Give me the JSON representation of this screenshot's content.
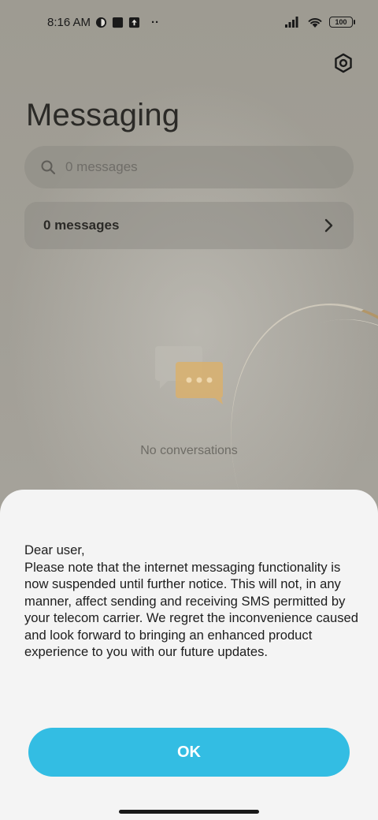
{
  "status_bar": {
    "time": "8:16 AM",
    "battery": "100",
    "more": "··"
  },
  "header": {
    "title": "Messaging",
    "settings_icon": "gear-icon"
  },
  "search": {
    "placeholder": "0 messages",
    "icon": "search-icon"
  },
  "messages_card": {
    "label": "0 messages",
    "icon": "chevron-right-icon"
  },
  "empty_state": {
    "icon": "chat-bubbles-icon",
    "text": "No conversations"
  },
  "dialog": {
    "message": "Dear user,\nPlease note that the internet messaging functionality is now suspended until further notice. This will not, in any manner, affect sending and receiving SMS permitted by your telecom carrier. We regret the inconvenience caused and look forward to bringing an enhanced product experience to you with our future updates.",
    "ok_label": "OK"
  },
  "colors": {
    "accent": "#33bde3",
    "sheet_bg": "#f4f4f4",
    "empty_icon": "#e0b36a"
  }
}
